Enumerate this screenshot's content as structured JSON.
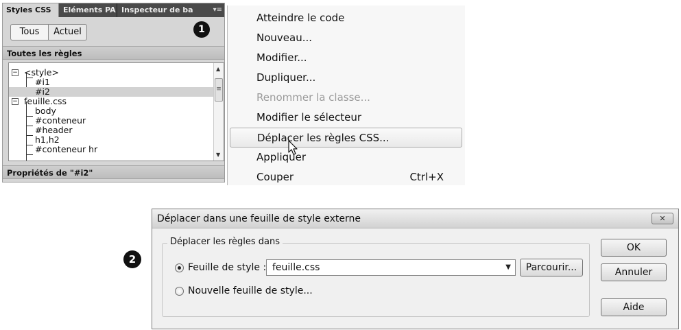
{
  "panel": {
    "tabs": [
      "Styles CSS",
      "Eléments PA",
      "Inspecteur de ba"
    ],
    "menu_glyph": "▾≡",
    "step_number": "❶",
    "mode_all": "Tous",
    "mode_current": "Actuel",
    "all_rules_header": "Toutes les règles",
    "rules": [
      {
        "label": "<style>",
        "level": 0,
        "expander": "−"
      },
      {
        "label": "#i1",
        "level": 1
      },
      {
        "label": "#i2",
        "level": 1,
        "selected": true
      },
      {
        "label": "feuille.css",
        "level": 0,
        "expander": "−"
      },
      {
        "label": "body",
        "level": 1
      },
      {
        "label": "#conteneur",
        "level": 1
      },
      {
        "label": "#header",
        "level": 1
      },
      {
        "label": "h1,h2",
        "level": 1
      },
      {
        "label": "#conteneur hr",
        "level": 1
      }
    ],
    "properties_header": "Propriétés de \"#i2\""
  },
  "context_menu": {
    "items": [
      {
        "label": "Atteindre le code"
      },
      {
        "label": "Nouveau..."
      },
      {
        "label": "Modifier..."
      },
      {
        "label": "Dupliquer..."
      },
      {
        "label": "Renommer la classe...",
        "disabled": true
      },
      {
        "label": "Modifier le sélecteur"
      },
      {
        "label": "Déplacer les règles CSS...",
        "highlighted": true
      },
      {
        "label": "Appliquer"
      },
      {
        "label": "Couper",
        "shortcut": "Ctrl+X"
      }
    ]
  },
  "dialog": {
    "title": "Déplacer dans une feuille de style externe",
    "close_glyph": "✕",
    "step_number": "❷",
    "group_label": "Déplacer les règles dans",
    "option_stylesheet": "Feuille de style :",
    "stylesheet_value": "feuille.css",
    "browse_button": "Parcourir...",
    "option_new_stylesheet": "Nouvelle feuille de style...",
    "ok_button": "OK",
    "cancel_button": "Annuler",
    "help_button": "Aide"
  }
}
